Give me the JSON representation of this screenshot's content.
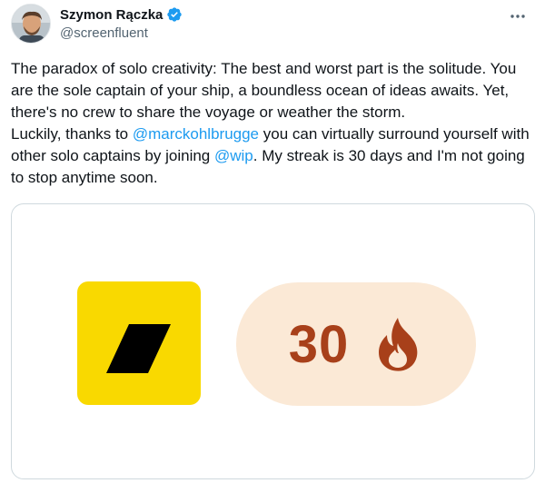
{
  "author": {
    "display_name": "Szymon Rączka",
    "handle": "@screenfluent",
    "verified_icon": "verified-badge-icon",
    "avatar_icon": "user-avatar-photo"
  },
  "actions": {
    "more_icon": "more-options-icon"
  },
  "tweet": {
    "part1": "The paradox of solo creativity: The best and worst part is the solitude. You are the sole captain of your ship, a boundless ocean of ideas awaits. Yet, there's no crew to share the voyage or weather the storm.",
    "part2": "Luckily, thanks to ",
    "mention1": "@marckohlbrugge",
    "part3": " you can virtually surround yourself with other solo captains by joining ",
    "mention2": "@wip",
    "part4": ". My streak is 30 days and I'm not going to stop anytime soon."
  },
  "media": {
    "logo_icon": "wip-logo-icon",
    "streak_count": "30",
    "streak_icon": "fire-icon"
  },
  "colors": {
    "link": "#1d9bf0",
    "logo_bg": "#f9d900",
    "pill_bg": "#fbe9d6",
    "streak": "#a8401a",
    "verified": "#1d9bf0"
  }
}
